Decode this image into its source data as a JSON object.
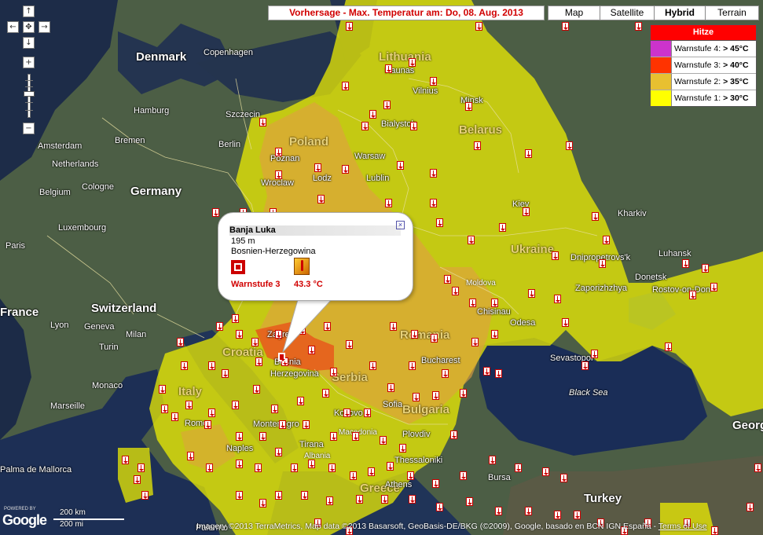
{
  "title": "Vorhersage - Max. Temperatur am: Do, 08. Aug. 2013",
  "map_types": [
    {
      "label": "Map",
      "selected": false
    },
    {
      "label": "Satellite",
      "selected": false
    },
    {
      "label": "Hybrid",
      "selected": true
    },
    {
      "label": "Terrain",
      "selected": false
    }
  ],
  "legend": {
    "title": "Hitze",
    "rows": [
      {
        "label": "Warnstufe 4:",
        "value": "> 45°C",
        "color": "#cc33cc"
      },
      {
        "label": "Warnstufe 3:",
        "value": "> 40°C",
        "color": "#ff3300"
      },
      {
        "label": "Warnstufe 2:",
        "value": "> 35°C",
        "color": "#e8c030"
      },
      {
        "label": "Warnstufe 1:",
        "value": "> 30°C",
        "color": "#ffff00"
      }
    ]
  },
  "nav": {
    "up": "↑",
    "left": "←",
    "center": "✥",
    "right": "→",
    "down": "↓",
    "zoom_in": "+",
    "zoom_out": "−"
  },
  "popup": {
    "city": "Banja Luka",
    "elevation": "195 m",
    "country": "Bosnien-Herzegowina",
    "warn_level": "Warnstufe 3",
    "temperature": "43.3  °C",
    "close": "×"
  },
  "places": {
    "countries": [
      "Denmark",
      "Lithuania",
      "Belarus",
      "Poland",
      "Germany",
      "Ukraine",
      "France",
      "Switzerland",
      "Croatia",
      "Romania",
      "Italy",
      "Serbia",
      "Bulgaria",
      "Greece",
      "Turkey",
      "Georg",
      "Moldova",
      "Albania",
      "Macedonia"
    ],
    "cities": [
      "Copenhagen",
      "Hamburg",
      "Szczecin",
      "Amsterdam",
      "Bremen",
      "Netherlands",
      "Berlin",
      "Poznan",
      "Warsaw",
      "Bialystok",
      "Minsk",
      "Kaunas",
      "Vilnius",
      "Belgium",
      "Cologne",
      "Wroclaw",
      "Lodz",
      "Lublin",
      "Kiev",
      "Kharkiv",
      "Luxembourg",
      "Paris",
      "Dnipropetrovs'k",
      "Luhansk",
      "Donetsk",
      "Rostov-on-Don",
      "Zaporizhzhya",
      "Chisinau",
      "Odesa",
      "Lyon",
      "Geneva",
      "Milan",
      "Turin",
      "Zagreb",
      "Bucharest",
      "Sevastopol",
      "Monaco",
      "Marseille",
      "Bosnia",
      "Herzegovina",
      "Sofia",
      "Kosovo",
      "Montenegro",
      "Rome",
      "Naples",
      "Tirana",
      "Plovdiv",
      "Thessaloniki",
      "Bursa",
      "Palma de Mallorca",
      "Palermo",
      "Athens"
    ],
    "seas": [
      "Black Sea"
    ]
  },
  "scale": {
    "km": "200 km",
    "mi": "200 mi"
  },
  "logo": {
    "powered": "POWERED BY",
    "name": "Google"
  },
  "attribution": "Imagery ©2013 TerraMetrics, Map data ©2013 Basarsoft, GeoBasis-DE/BKG (©2009), Google, basado en BCN IGN España - ",
  "terms": "Terms of Use"
}
